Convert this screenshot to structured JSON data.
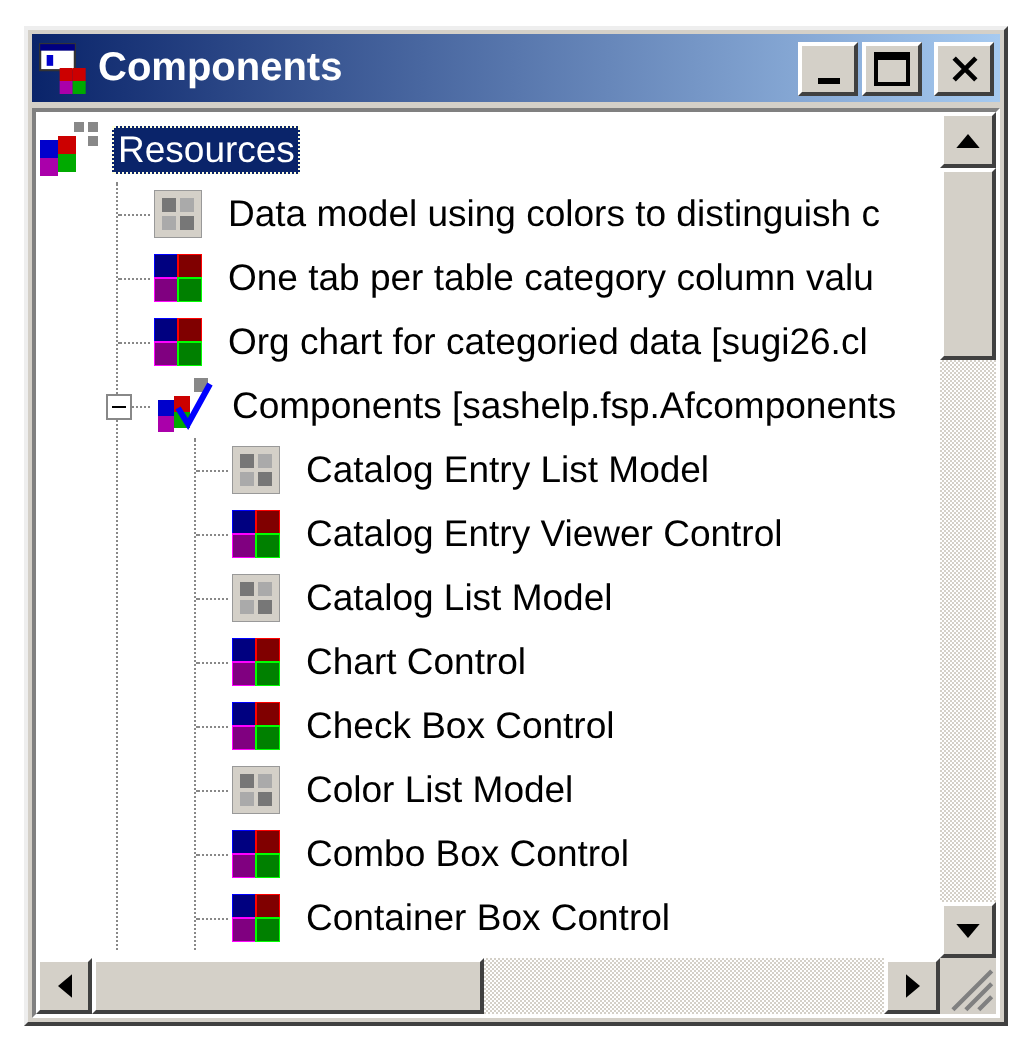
{
  "window": {
    "title": "Components"
  },
  "tree": [
    {
      "label": "Resources",
      "kind": "resources",
      "selected": true,
      "expanded": true,
      "children": [
        {
          "label": "Data model using colors to distinguish c",
          "kind": "model",
          "selected": false
        },
        {
          "label": "One tab per table category column valu",
          "kind": "control",
          "selected": false
        },
        {
          "label": "Org chart for categoried data [sugi26.cl",
          "kind": "control",
          "selected": false
        },
        {
          "label": "Components [sashelp.fsp.Afcomponents",
          "kind": "components",
          "selected": false,
          "expanded": true,
          "children": [
            {
              "label": "Catalog Entry List Model",
              "kind": "model",
              "selected": false
            },
            {
              "label": "Catalog Entry Viewer Control",
              "kind": "control",
              "selected": false
            },
            {
              "label": "Catalog List Model",
              "kind": "model",
              "selected": false
            },
            {
              "label": "Chart Control",
              "kind": "control",
              "selected": false
            },
            {
              "label": "Check Box Control",
              "kind": "control",
              "selected": false
            },
            {
              "label": "Color List Model",
              "kind": "model",
              "selected": false
            },
            {
              "label": "Combo Box Control",
              "kind": "control",
              "selected": false
            },
            {
              "label": "Container Box Control",
              "kind": "control",
              "selected": false
            }
          ]
        }
      ]
    }
  ]
}
